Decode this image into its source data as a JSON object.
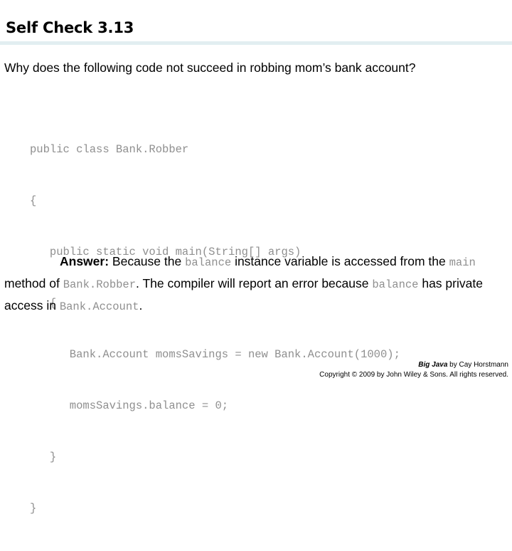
{
  "slide": {
    "title": "Self Check 3.13",
    "rule_color": "#e2eef1",
    "background_color": "#ffffff",
    "code_color": "#8f8f8f",
    "text_color": "#000000"
  },
  "question": {
    "text": "Why does the following code not succeed in robbing mom’s bank account?"
  },
  "code": {
    "lines": [
      "public class Bank.Robber",
      "{",
      "   public static void main(String[] args)",
      "   {",
      "      Bank.Account momsSavings = new Bank.Account(1000);",
      "      momsSavings.balance = 0;",
      "   }",
      "}"
    ]
  },
  "answer": {
    "lead": "Answer:",
    "part1": " Because the ",
    "code1": "balance",
    "part2": " instance variable is accessed from the ",
    "code2": "main",
    "part3": " method of ",
    "code3": "Bank.Robber",
    "part4": ". The compiler will report an error because ",
    "code4": "balance",
    "part5": " has private access in ",
    "code5": "Bank.Account",
    "part6": "."
  },
  "footer": {
    "book_title": "Big Java",
    "author_line": " by Cay Horstmann",
    "copyright": "Copyright © 2009 by John Wiley & Sons.  All rights reserved."
  }
}
